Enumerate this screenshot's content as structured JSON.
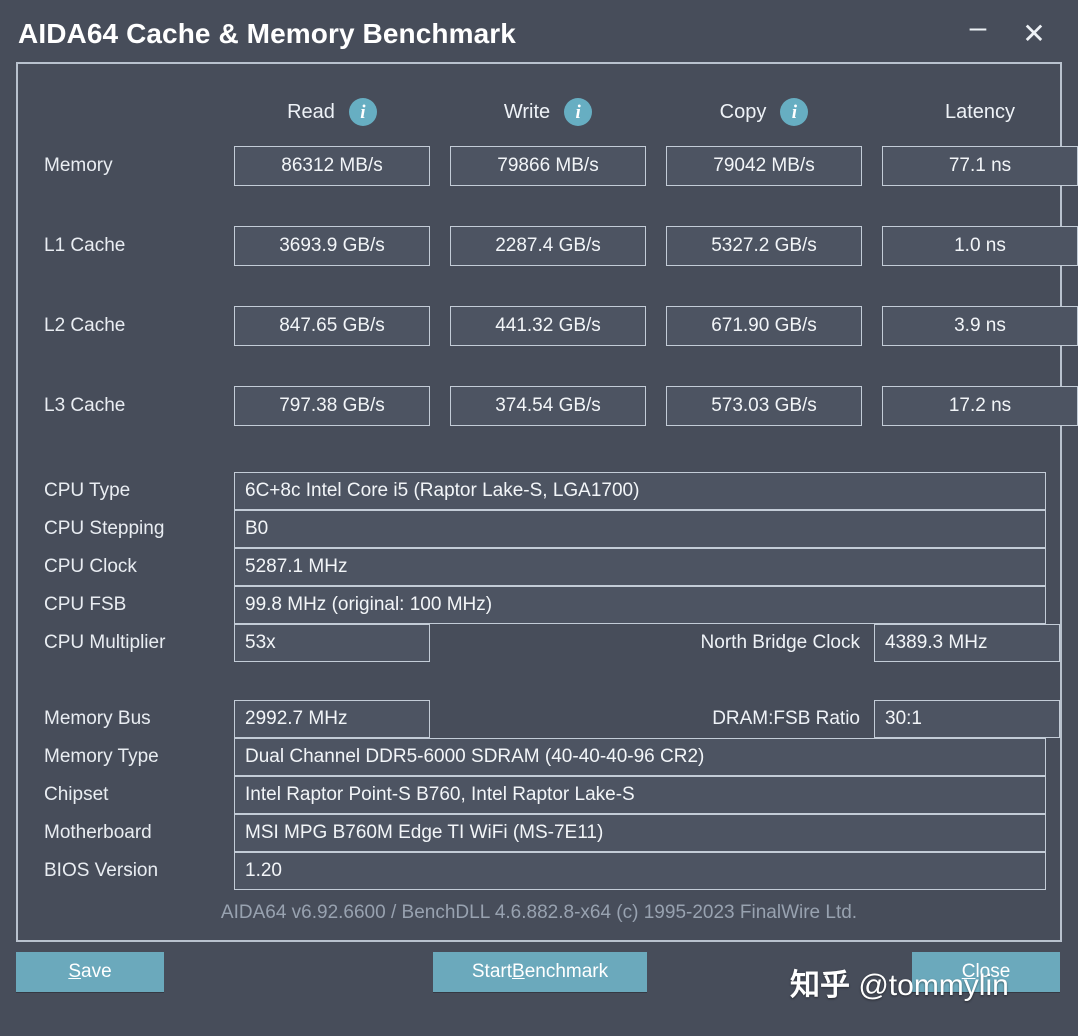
{
  "window": {
    "title": "AIDA64 Cache & Memory Benchmark",
    "minimize_label": "–",
    "close_label": "✕"
  },
  "bench_table": {
    "columns": [
      {
        "label": "Read",
        "icon": "info-icon",
        "has_info": true
      },
      {
        "label": "Write",
        "icon": "info-icon",
        "has_info": true
      },
      {
        "label": "Copy",
        "icon": "info-icon",
        "has_info": true
      },
      {
        "label": "Latency",
        "icon": null,
        "has_info": false
      }
    ],
    "rows": [
      {
        "label": "Memory",
        "read": "86312 MB/s",
        "write": "79866 MB/s",
        "copy": "79042 MB/s",
        "latency": "77.1 ns"
      },
      {
        "label": "L1 Cache",
        "read": "3693.9 GB/s",
        "write": "2287.4 GB/s",
        "copy": "5327.2 GB/s",
        "latency": "1.0 ns"
      },
      {
        "label": "L2 Cache",
        "read": "847.65 GB/s",
        "write": "441.32 GB/s",
        "copy": "671.90 GB/s",
        "latency": "3.9 ns"
      },
      {
        "label": "L3 Cache",
        "read": "797.38 GB/s",
        "write": "374.54 GB/s",
        "copy": "573.03 GB/s",
        "latency": "17.2 ns"
      }
    ]
  },
  "cpu_info": {
    "cpu_type_label": "CPU Type",
    "cpu_type_value": "6C+8c Intel Core i5  (Raptor Lake-S, LGA1700)",
    "cpu_stepping_label": "CPU Stepping",
    "cpu_stepping_value": "B0",
    "cpu_clock_label": "CPU Clock",
    "cpu_clock_value": "5287.1 MHz",
    "cpu_fsb_label": "CPU FSB",
    "cpu_fsb_value": "99.8 MHz  (original: 100 MHz)",
    "cpu_multiplier_label": "CPU Multiplier",
    "cpu_multiplier_value": "53x",
    "north_bridge_label": "North Bridge Clock",
    "north_bridge_value": "4389.3 MHz"
  },
  "memory_info": {
    "memory_bus_label": "Memory Bus",
    "memory_bus_value": "2992.7 MHz",
    "dram_fsb_label": "DRAM:FSB Ratio",
    "dram_fsb_value": "30:1",
    "memory_type_label": "Memory Type",
    "memory_type_value": "Dual Channel DDR5-6000 SDRAM  (40-40-40-96 CR2)",
    "chipset_label": "Chipset",
    "chipset_value": "Intel Raptor Point-S B760, Intel Raptor Lake-S",
    "motherboard_label": "Motherboard",
    "motherboard_value": "MSI MPG B760M Edge TI WiFi (MS-7E11)",
    "bios_label": "BIOS Version",
    "bios_value": "1.20"
  },
  "footer": {
    "version_text": "AIDA64 v6.92.6600 / BenchDLL 4.6.882.8-x64  (c) 1995-2023 FinalWire Ltd."
  },
  "buttons": {
    "save_prefix": "",
    "save_accel": "S",
    "save_rest": "ave",
    "start_prefix": "Start ",
    "start_accel": "B",
    "start_rest": "enchmark",
    "close_prefix": "",
    "close_accel": "C",
    "close_rest": "lose"
  },
  "watermark": {
    "site": "知乎",
    "user": "@tommylin"
  },
  "colors": {
    "window_bg": "#474d5a",
    "field_bg": "#4d5462",
    "field_border": "#c3ccd7",
    "accent_teal": "#6ba9bc",
    "text_primary": "#f2f5f8",
    "text_muted": "#98a2b0"
  }
}
